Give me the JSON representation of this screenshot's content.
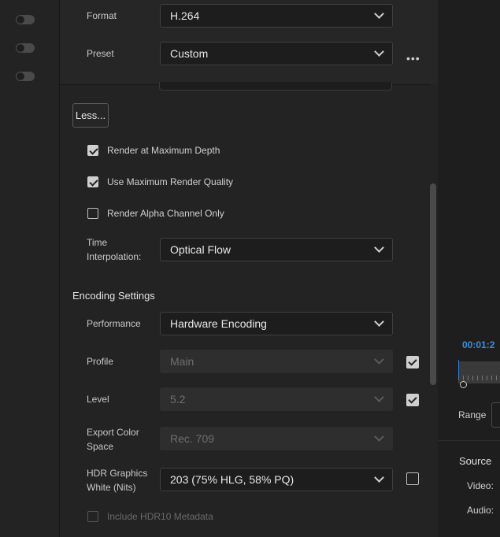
{
  "left_rail": {
    "toggles": [
      {
        "state": "off"
      },
      {
        "state": "off"
      },
      {
        "state": "off"
      }
    ]
  },
  "format": {
    "label": "Format",
    "value": "H.264"
  },
  "preset": {
    "label": "Preset",
    "value": "Custom",
    "more_glyph": "•••"
  },
  "less_button": "Less...",
  "options": [
    {
      "label": "Render at Maximum Depth",
      "checked": true
    },
    {
      "label": "Use Maximum Render Quality",
      "checked": true
    },
    {
      "label": "Render Alpha Channel Only",
      "checked": false
    }
  ],
  "time_interpolation": {
    "label_line1": "Time",
    "label_line2": "Interpolation:",
    "value": "Optical Flow"
  },
  "encoding": {
    "title": "Encoding Settings",
    "performance": {
      "label": "Performance",
      "value": "Hardware Encoding"
    },
    "profile": {
      "label": "Profile",
      "value": "Main",
      "enabled": false,
      "side_checked": true
    },
    "level": {
      "label": "Level",
      "value": "5.2",
      "enabled": false,
      "side_checked": true
    },
    "color_space": {
      "label_line1": "Export Color",
      "label_line2": "Space",
      "value": "Rec. 709",
      "enabled": false
    },
    "hdr_white": {
      "label_line1": "HDR Graphics",
      "label_line2": "White (Nits)",
      "value": "203 (75% HLG, 58% PQ)",
      "side_checked": false
    },
    "hdr10_metadata": {
      "label": "Include HDR10 Metadata",
      "checked": false,
      "enabled": false
    }
  },
  "right_panel": {
    "timecode": "00:01:2",
    "range_label": "Range",
    "source_title": "Source",
    "video_label": "Video:",
    "audio_label": "Audio:"
  },
  "colors": {
    "accent": "#3a8fd9",
    "panel": "#232323",
    "field": "#1d1d1d"
  }
}
